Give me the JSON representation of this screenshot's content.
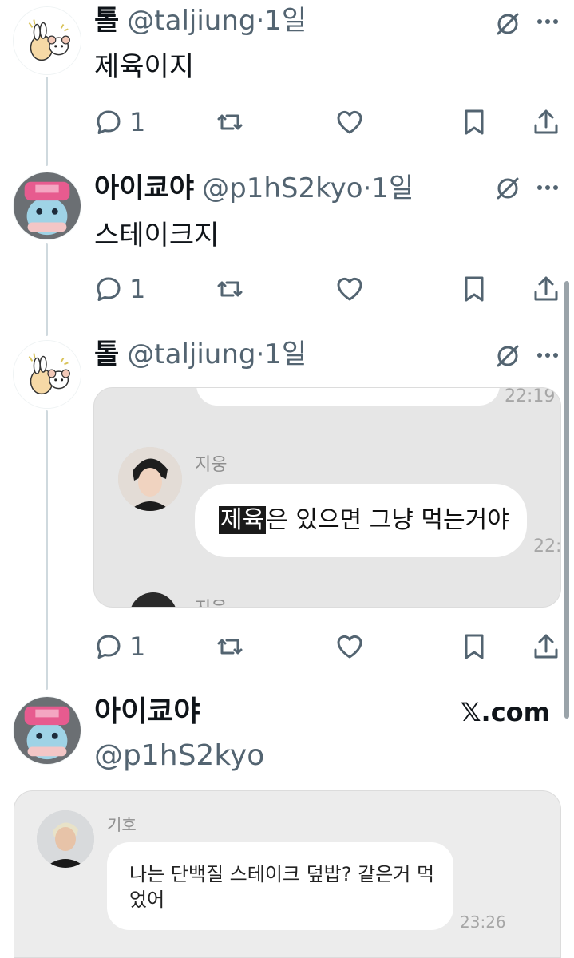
{
  "tweets": [
    {
      "name": "톨",
      "handle": "@taljiung",
      "dot": "·",
      "time": "1일",
      "text": "제육이지",
      "reply_count": "1"
    },
    {
      "name": "아이쿄야",
      "handle": "@p1hS2kyo",
      "dot": "·",
      "time": "1일",
      "text": "스테이크지",
      "reply_count": "1"
    },
    {
      "name": "톨",
      "handle": "@taljiung",
      "dot": "·",
      "time": "1일",
      "reply_count": "1",
      "media": {
        "top_time": "22:19",
        "sender": "지웅",
        "highlighted": "제육",
        "message_rest": "은 있으면 그냥 먹는거야",
        "bubble_time": "22:",
        "peek_sender": "지웅"
      }
    }
  ],
  "quote_card": {
    "name": "아이쿄야",
    "handle": "@p1hS2kyo",
    "site": "𝕏.com",
    "media": {
      "sender": "기호",
      "message": "나는 단백질 스테이크 덮밥? 같은거 먹었어",
      "time": "23:26"
    }
  },
  "colors": {
    "text_primary": "#0f1419",
    "text_secondary": "#536471",
    "thread_line": "#cfd9de",
    "avatar_hat_pink": "#e75b8f"
  },
  "icons": [
    "grok-icon",
    "more-icon",
    "reply-icon",
    "retweet-icon",
    "like-icon",
    "bookmark-icon",
    "share-icon"
  ]
}
